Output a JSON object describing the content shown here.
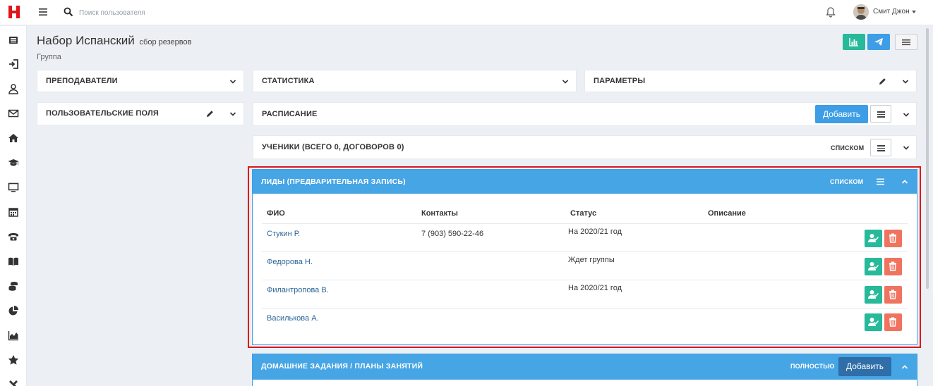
{
  "topbar": {
    "search_placeholder": "Поиск пользователя",
    "username": "Смит Джон"
  },
  "page": {
    "title": "Набор Испанский",
    "subtitle": "сбор резервов",
    "group_label": "Группа"
  },
  "panels": {
    "teachers": "ПРЕПОДАВАТЕЛИ",
    "custom_fields": "ПОЛЬЗОВАТЕЛЬСКИЕ ПОЛЯ",
    "statistics": "СТАТИСТИКА",
    "parameters": "ПАРАМЕТРЫ",
    "schedule": "РАСПИСАНИЕ",
    "schedule_add": "Добавить",
    "students": "УЧЕНИКИ (ВСЕГО 0, ДОГОВОРОВ 0)",
    "students_view": "СПИСКОМ",
    "homework": "ДОМАШНИЕ ЗАДАНИЯ / ПЛАНЫ ЗАНЯТИЙ",
    "homework_view": "ПОЛНОСТЬЮ",
    "homework_add": "Добавить"
  },
  "leads": {
    "title": "ЛИДЫ (ПРЕДВАРИТЕЛЬНАЯ ЗАПИСЬ)",
    "view": "СПИСКОМ",
    "columns": [
      "ФИО",
      "Контакты",
      "Статус",
      "Описание"
    ],
    "rows": [
      {
        "name": "Стукин Р.",
        "contact": "7 (903) 590-22-46",
        "status": "На 2020/21 год",
        "description": ""
      },
      {
        "name": "Федорова Н.",
        "contact": "",
        "status": "Ждет группы",
        "description": ""
      },
      {
        "name": "Филантропова В.",
        "contact": "",
        "status": "На 2020/21 год",
        "description": ""
      },
      {
        "name": "Василькова А.",
        "contact": "",
        "status": "",
        "description": ""
      }
    ]
  },
  "colors": {
    "brand": "#e0141a",
    "accent_blue": "#46a5e4",
    "accent_green": "#26b99a",
    "danger": "#f0735f",
    "add_dark": "#2f6ea8"
  },
  "sidebar_icons": [
    "list-icon",
    "sign-in-icon",
    "user-icon",
    "envelope-icon",
    "home-icon",
    "graduation-cap-icon",
    "monitor-icon",
    "calendar-icon",
    "phone-icon",
    "book-icon",
    "coins-icon",
    "pie-chart-icon",
    "area-chart-icon",
    "star-icon",
    "tools-icon"
  ]
}
